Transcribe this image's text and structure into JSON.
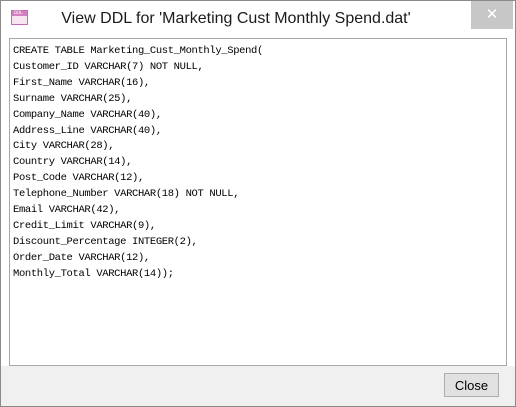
{
  "window": {
    "title": "View DDL for 'Marketing Cust Monthly Spend.dat'",
    "icon_label": "DDL",
    "close_glyph": "✕"
  },
  "ddl": {
    "lines": [
      "CREATE TABLE Marketing_Cust_Monthly_Spend(",
      "Customer_ID VARCHAR(7) NOT NULL,",
      "First_Name VARCHAR(16),",
      "Surname VARCHAR(25),",
      "Company_Name VARCHAR(40),",
      "Address_Line VARCHAR(40),",
      "City VARCHAR(28),",
      "Country VARCHAR(14),",
      "Post_Code VARCHAR(12),",
      "Telephone_Number VARCHAR(18) NOT NULL,",
      "Email VARCHAR(42),",
      "Credit_Limit VARCHAR(9),",
      "Discount_Percentage INTEGER(2),",
      "Order_Date VARCHAR(12),",
      "Monthly_Total VARCHAR(14));"
    ]
  },
  "footer": {
    "close_label": "Close"
  },
  "colors": {
    "icon_accent": "#d27fc1",
    "close_x_bg": "#c7c7c7"
  }
}
